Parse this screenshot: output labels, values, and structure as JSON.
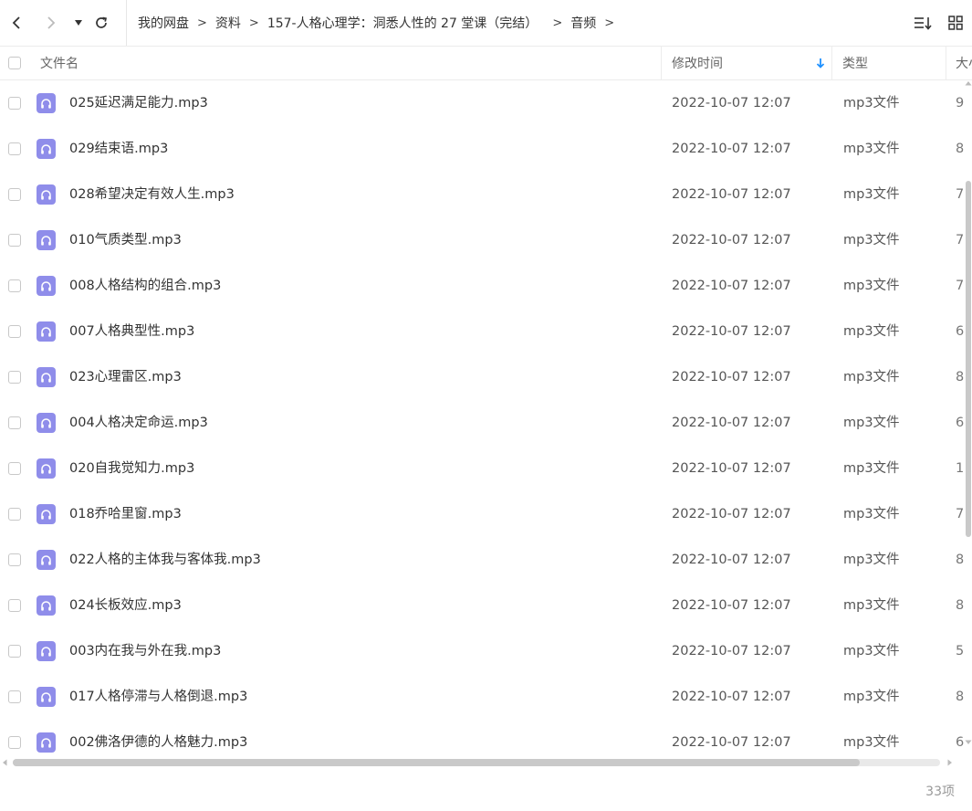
{
  "toolbar": {
    "back_icon": "chevron-left-icon",
    "forward_icon": "chevron-right-icon",
    "dropdown_icon": "caret-down-icon",
    "refresh_icon": "refresh-icon",
    "sort_icon": "sort-list-icon",
    "view_icon": "grid-view-icon"
  },
  "breadcrumb": {
    "items": [
      "我的网盘",
      "资料",
      "157-人格心理学：洞悉人性的 27 堂课（完结）",
      "音频"
    ],
    "separator": ">"
  },
  "columns": {
    "name": "文件名",
    "modified": "修改时间",
    "type": "类型",
    "size": "大小"
  },
  "files": [
    {
      "name": "025延迟满足能力.mp3",
      "modified": "2022-10-07 12:07",
      "type": "mp3文件",
      "size": "9"
    },
    {
      "name": "029结束语.mp3",
      "modified": "2022-10-07 12:07",
      "type": "mp3文件",
      "size": "8"
    },
    {
      "name": "028希望决定有效人生.mp3",
      "modified": "2022-10-07 12:07",
      "type": "mp3文件",
      "size": "7"
    },
    {
      "name": "010气质类型.mp3",
      "modified": "2022-10-07 12:07",
      "type": "mp3文件",
      "size": "7"
    },
    {
      "name": "008人格结构的组合.mp3",
      "modified": "2022-10-07 12:07",
      "type": "mp3文件",
      "size": "7"
    },
    {
      "name": "007人格典型性.mp3",
      "modified": "2022-10-07 12:07",
      "type": "mp3文件",
      "size": "6"
    },
    {
      "name": "023心理雷区.mp3",
      "modified": "2022-10-07 12:07",
      "type": "mp3文件",
      "size": "8"
    },
    {
      "name": "004人格决定命运.mp3",
      "modified": "2022-10-07 12:07",
      "type": "mp3文件",
      "size": "6"
    },
    {
      "name": "020自我觉知力.mp3",
      "modified": "2022-10-07 12:07",
      "type": "mp3文件",
      "size": "1"
    },
    {
      "name": "018乔哈里窗.mp3",
      "modified": "2022-10-07 12:07",
      "type": "mp3文件",
      "size": "7"
    },
    {
      "name": "022人格的主体我与客体我.mp3",
      "modified": "2022-10-07 12:07",
      "type": "mp3文件",
      "size": "8"
    },
    {
      "name": "024长板效应.mp3",
      "modified": "2022-10-07 12:07",
      "type": "mp3文件",
      "size": "8"
    },
    {
      "name": "003内在我与外在我.mp3",
      "modified": "2022-10-07 12:07",
      "type": "mp3文件",
      "size": "5"
    },
    {
      "name": "017人格停滞与人格倒退.mp3",
      "modified": "2022-10-07 12:07",
      "type": "mp3文件",
      "size": "8"
    },
    {
      "name": "002佛洛伊德的人格魅力.mp3",
      "modified": "2022-10-07 12:07",
      "type": "mp3文件",
      "size": "6"
    }
  ],
  "file_icon": "headphones-icon",
  "file_icon_color": "#8f8dea",
  "sort_indicator_color": "#1e90ff",
  "footer": {
    "count": "33项"
  }
}
